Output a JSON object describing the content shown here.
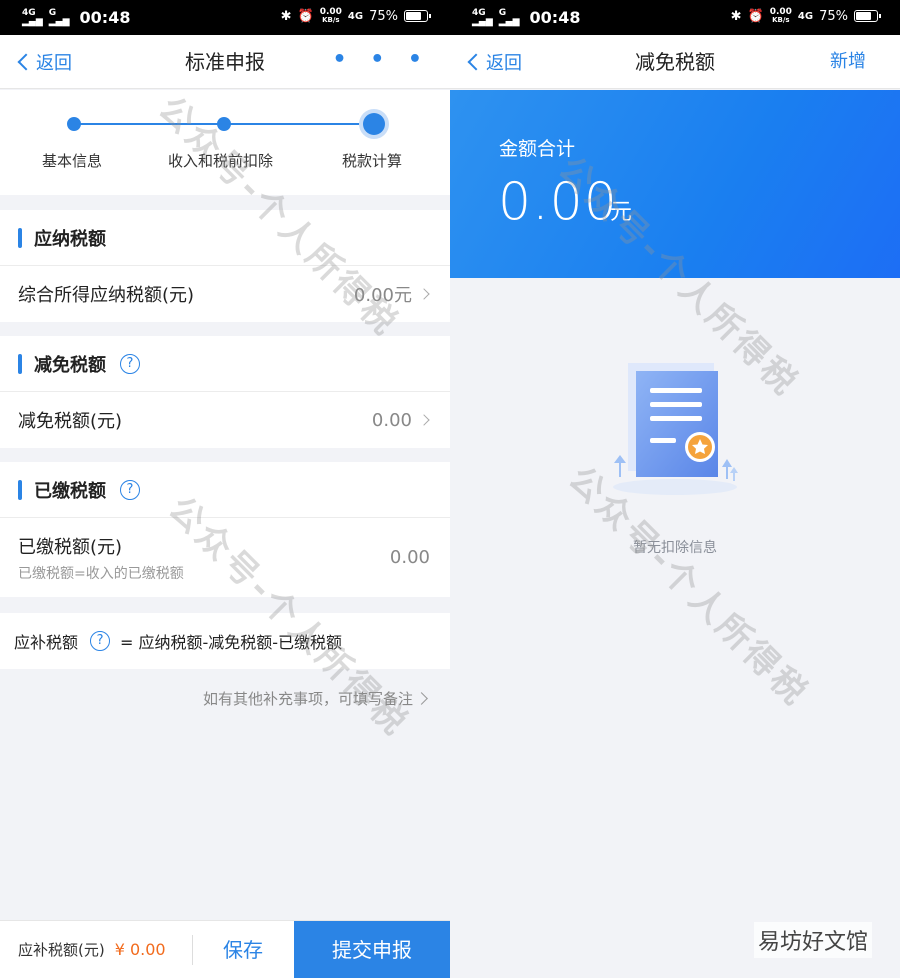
{
  "status": {
    "network": "4G",
    "time": "00:48",
    "speed_value": "0.00",
    "speed_unit": "KB/s",
    "network_right": "4G",
    "battery": "75%"
  },
  "left": {
    "nav": {
      "back": "返回",
      "title": "标准申报",
      "more": "• • •"
    },
    "steps": [
      "基本信息",
      "收入和税前扣除",
      "税款计算"
    ],
    "payable": {
      "title": "应纳税额",
      "row_label": "综合所得应纳税额(元)",
      "row_value": "0.00元"
    },
    "reduction": {
      "title": "减免税额",
      "help": "?",
      "row_label": "减免税额(元)",
      "row_value": "0.00"
    },
    "paid": {
      "title": "已缴税额",
      "help": "?",
      "row_label": "已缴税额(元)",
      "row_sub": "已缴税额=收入的已缴税额",
      "row_value": "0.00"
    },
    "formula": {
      "label": "应补税额",
      "help": "?",
      "expr": "= 应纳税额-减免税额-已缴税额"
    },
    "note": "如有其他补充事项，可填写备注",
    "bottom": {
      "label": "应补税额(元)",
      "amount": "¥ 0.00",
      "save": "保存",
      "submit": "提交申报"
    }
  },
  "right": {
    "nav": {
      "back": "返回",
      "title": "减免税额",
      "add": "新增"
    },
    "banner": {
      "label": "金额合计",
      "amount": "0.00",
      "unit": "元"
    },
    "empty_text": "暂无扣除信息"
  },
  "watermark": "公众号-个人所得税",
  "corner_watermark": "易坊好文馆",
  "colors": {
    "accent": "#2b84e5",
    "amount_orange": "#f26b1d"
  }
}
